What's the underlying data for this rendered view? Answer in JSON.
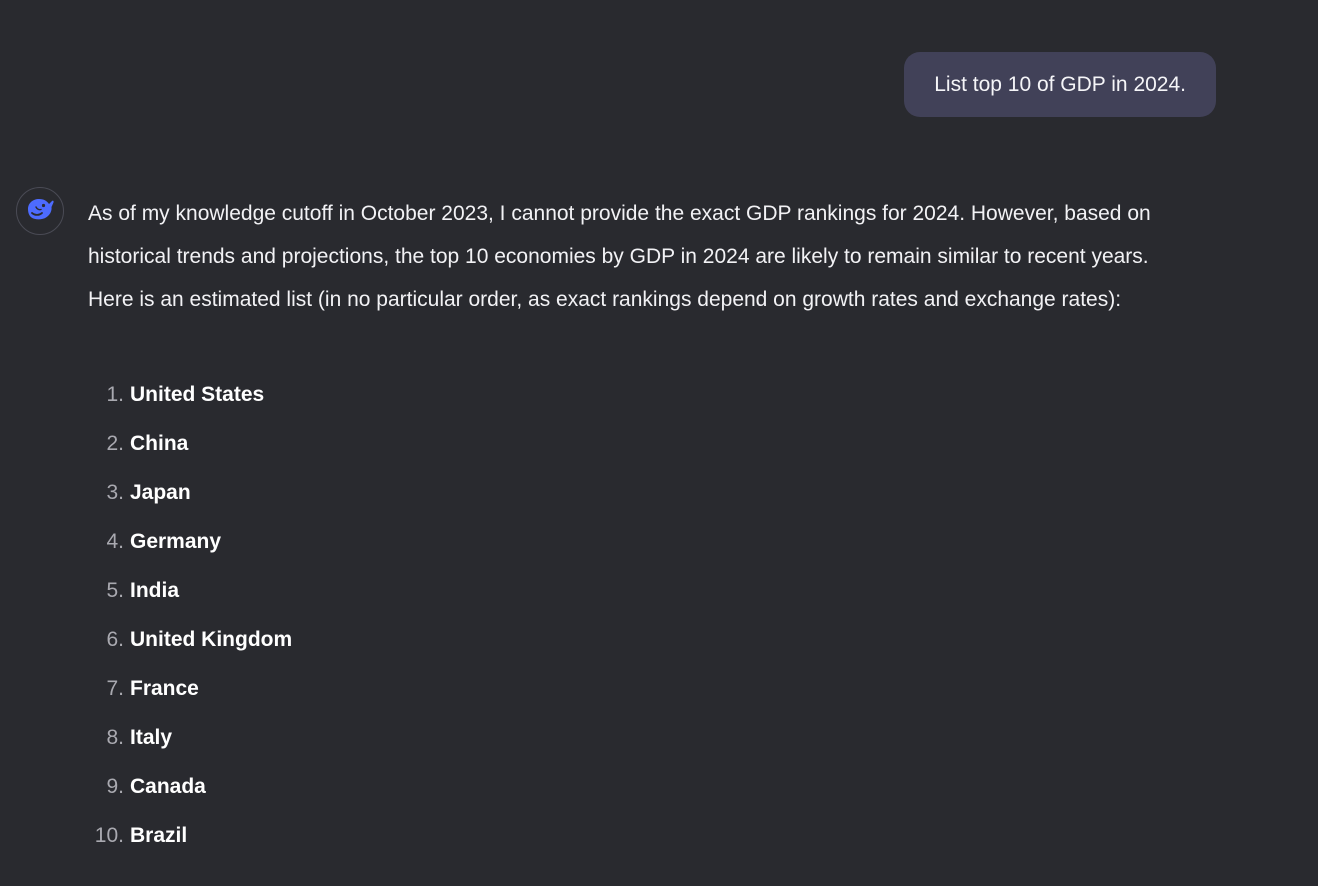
{
  "conversation": {
    "user_message": "List top 10 of GDP in 2024.",
    "assistant": {
      "avatar_icon": "whale-logo-icon",
      "avatar_color": "#4d6bfe",
      "intro": "As of my knowledge cutoff in October 2023, I cannot provide the exact GDP rankings for 2024. However, based on historical trends and projections, the top 10 economies by GDP in 2024 are likely to remain similar to recent years. Here is an estimated list (in no particular order, as exact rankings depend on growth rates and exchange rates):",
      "list": [
        {
          "number": "1.",
          "country": "United States"
        },
        {
          "number": "2.",
          "country": "China"
        },
        {
          "number": "3.",
          "country": "Japan"
        },
        {
          "number": "4.",
          "country": "Germany"
        },
        {
          "number": "5.",
          "country": "India"
        },
        {
          "number": "6.",
          "country": "United Kingdom"
        },
        {
          "number": "7.",
          "country": "France"
        },
        {
          "number": "8.",
          "country": "Italy"
        },
        {
          "number": "9.",
          "country": "Canada"
        },
        {
          "number": "10.",
          "country": "Brazil"
        }
      ]
    }
  },
  "colors": {
    "background": "#292a2f",
    "user_bubble": "#414158",
    "text": "#f2f2f5",
    "list_number": "#a9a9b0"
  }
}
